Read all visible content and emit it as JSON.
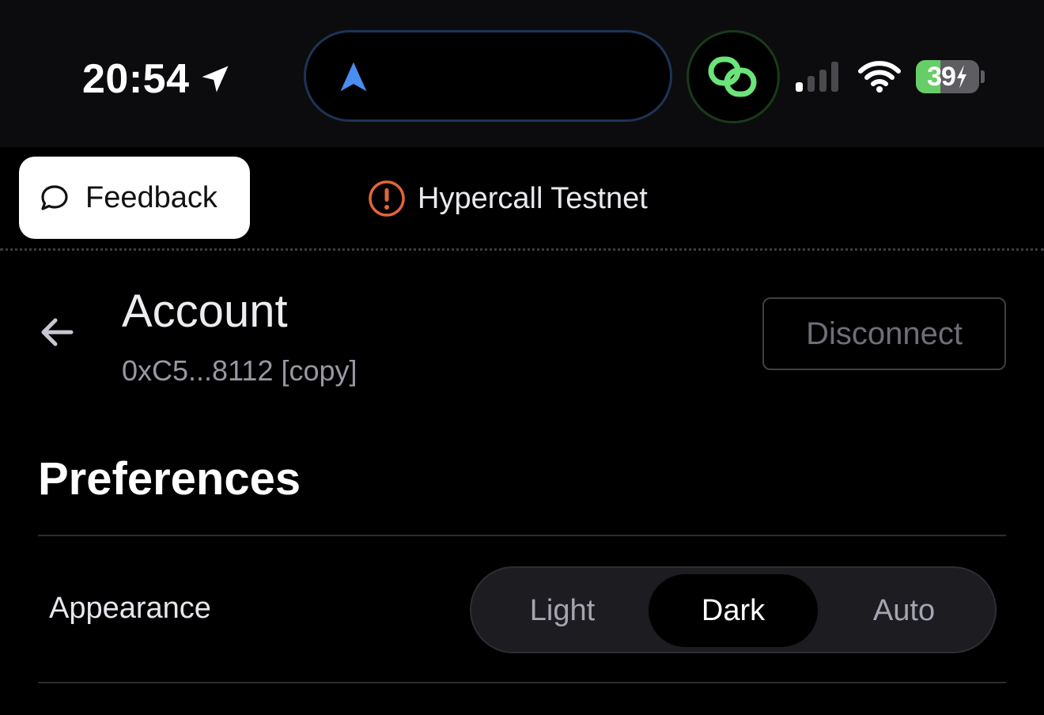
{
  "status_bar": {
    "time": "20:54",
    "battery_percent": "39",
    "battery_level": 0.39,
    "signal_bars_active": 1,
    "signal_bars_total": 4,
    "icons": [
      "location-arrow-icon",
      "navigation-arrow-icon",
      "link-app-icon",
      "signal-icon",
      "wifi-icon",
      "battery-charging-icon"
    ]
  },
  "top_bar": {
    "feedback_label": "Feedback",
    "network_label": "Hypercall Testnet",
    "network_warning_color": "#e0663a"
  },
  "account": {
    "title": "Account",
    "address": "0xC5...8112 [copy]",
    "disconnect_label": "Disconnect"
  },
  "preferences": {
    "title": "Preferences",
    "appearance_label": "Appearance",
    "options": [
      "Light",
      "Dark",
      "Auto"
    ],
    "selected": "Dark"
  },
  "colors": {
    "background": "#000000",
    "status_bar_bg": "#0c0c0e",
    "battery_green": "#67ce67",
    "link_green": "#6be47a",
    "nav_blue": "#4a8cf0"
  }
}
